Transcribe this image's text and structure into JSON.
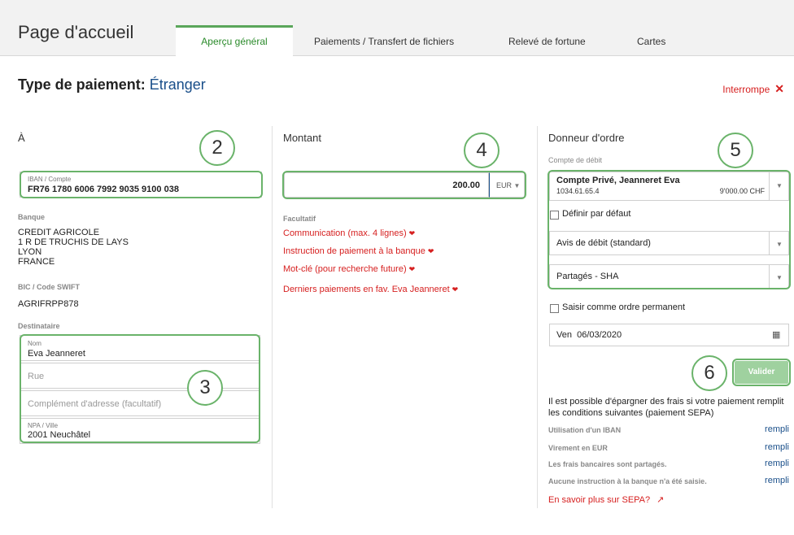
{
  "header": {
    "title": "Page d'accueil",
    "tabs": [
      {
        "label": "Aperçu général"
      },
      {
        "label": "Paiements / Transfert de fichiers"
      },
      {
        "label": "Relevé de fortune"
      },
      {
        "label": "Cartes"
      }
    ]
  },
  "payment": {
    "type_label": "Type de paiement:",
    "type_value": "Étranger",
    "cancel_label": "Interrompe"
  },
  "recipient": {
    "heading": "À",
    "iban_label": "IBAN / Compte",
    "iban_value": "FR76 1780 6006 7992 9035 9100 038",
    "bank_label": "Banque",
    "bank_lines": [
      "CREDIT AGRICOLE",
      "1 R DE TRUCHIS DE LAYS",
      "LYON",
      "FRANCE"
    ],
    "bic_label": "BIC / Code SWIFT",
    "bic_value": "AGRIFRPP878",
    "dest_label": "Destinataire",
    "name_label": "Nom",
    "name_value": "Eva Jeanneret",
    "street_placeholder": "Rue",
    "complement_placeholder": "Complément d'adresse (facultatif)",
    "npa_label": "NPA / Ville",
    "npa_value": "2001 Neuchâtel"
  },
  "amount": {
    "heading": "Montant",
    "value": "200.00",
    "currency": "EUR",
    "optional_label": "Facultatif",
    "links": [
      "Communication (max. 4 lignes)",
      "Instruction de paiement à la banque",
      "Mot-clé (pour recherche future)"
    ],
    "history_link": "Derniers paiements en fav. Eva Jeanneret"
  },
  "orderer": {
    "heading": "Donneur d'ordre",
    "debit_label": "Compte de débit",
    "account_name": "Compte Privé, Jeanneret Eva",
    "account_number": "1034.61.65.4",
    "account_balance": "9'000.00 CHF",
    "default_label": "Définir par défaut",
    "notice_select": "Avis de débit (standard)",
    "fees_select": "Partagés - SHA",
    "standing_order_label": "Saisir comme ordre permanent",
    "date_day": "Ven",
    "date_value": "06/03/2020",
    "submit_label": "Valider",
    "sepa_text": "Il est possible d'épargner des frais si votre paiement remplit les conditions suivantes (paiement SEPA)",
    "conditions": [
      {
        "label": "Utilisation d'un IBAN",
        "status": "rempli"
      },
      {
        "label": "Virement en EUR",
        "status": "rempli"
      },
      {
        "label": "Les frais bancaires sont partagés.",
        "status": "rempli"
      },
      {
        "label": "Aucune instruction à la banque n'a été saisie.",
        "status": "rempli"
      }
    ],
    "sepa_link": "En savoir plus sur SEPA?"
  },
  "callouts": [
    "2",
    "3",
    "4",
    "5",
    "6"
  ],
  "colors": {
    "accent_green": "#6ab36a",
    "link_red": "#d62020",
    "value_blue": "#1a4f8a"
  }
}
